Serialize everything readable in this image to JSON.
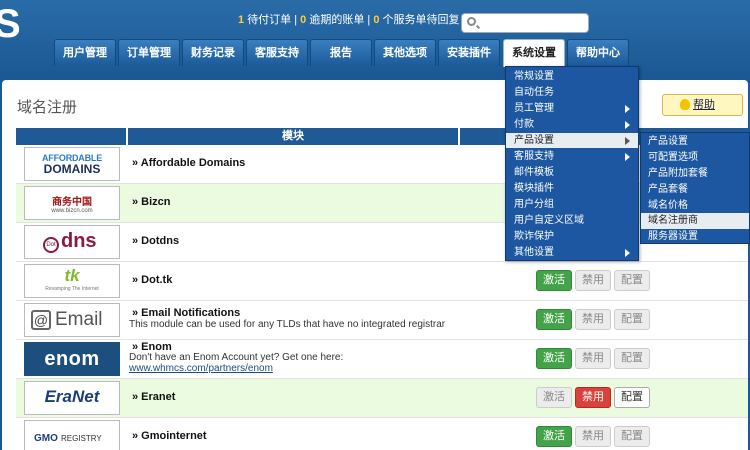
{
  "header": {
    "logo_text": "S",
    "stats": [
      {
        "count": "1",
        "label": "待付订单"
      },
      {
        "count": "0",
        "label": "逾期的账单"
      },
      {
        "count": "0",
        "label": "个服务单待回复"
      }
    ],
    "search": {
      "value": ""
    }
  },
  "nav": [
    {
      "label": "用户管理"
    },
    {
      "label": "订单管理"
    },
    {
      "label": "财务记录"
    },
    {
      "label": "客服支持"
    },
    {
      "label": "报告"
    },
    {
      "label": "其他选项"
    },
    {
      "label": "安装插件"
    },
    {
      "label": "系统设置",
      "active": true
    },
    {
      "label": "帮助中心"
    }
  ],
  "page": {
    "title": "域名注册",
    "help_label": "帮助"
  },
  "table": {
    "columns": [
      "",
      "模块",
      ""
    ],
    "rows": [
      {
        "name": "» Affordable Domains",
        "logo": [
          "AFFORDABLE",
          "DOMAINS"
        ],
        "alt": false
      },
      {
        "name": "» Bizcn",
        "logo": [
          "商务中国",
          "www.bizcn.com"
        ],
        "alt": true
      },
      {
        "name": "» Dotdns",
        "logo": [
          "Dot",
          "dns"
        ],
        "alt": false
      },
      {
        "name": "» Dot.tk",
        "logo": [
          "tk",
          "Revamping The Internet"
        ],
        "alt": false,
        "buttons": [
          "激活",
          "禁用",
          "配置"
        ]
      },
      {
        "name": "» Email Notifications",
        "desc": "This module can be used for any TLDs that have no integrated registrar",
        "logo": [
          "@",
          "Email"
        ],
        "alt": false,
        "buttons": [
          "激活",
          "禁用",
          "配置"
        ]
      },
      {
        "name": "» Enom",
        "desc": "Don't have an Enom Account yet? Get one here:",
        "link": "www.whmcs.com/partners/enom",
        "logo": [
          "enom"
        ],
        "alt": false,
        "buttons": [
          "激活",
          "禁用",
          "配置"
        ]
      },
      {
        "name": "» Eranet",
        "logo": [
          "EraNet"
        ],
        "alt": true,
        "buttons": [
          "激活",
          "禁用",
          "配置"
        ]
      },
      {
        "name": "» Gmointernet",
        "logo": [
          "GMO",
          "REGISTRY"
        ],
        "alt": false,
        "buttons": [
          "激活",
          "禁用",
          "配置"
        ]
      }
    ]
  },
  "system_menu": [
    {
      "label": "常规设置"
    },
    {
      "label": "自动任务"
    },
    {
      "label": "员工管理",
      "submenu": true
    },
    {
      "label": "付款",
      "submenu": true
    },
    {
      "label": "产品设置",
      "submenu": true,
      "highlighted": true
    },
    {
      "label": "客服支持",
      "submenu": true
    },
    {
      "label": "邮件模板"
    },
    {
      "label": "模块插件"
    },
    {
      "label": "用户分组"
    },
    {
      "label": "用户自定义区域"
    },
    {
      "label": "欺诈保护"
    },
    {
      "label": "其他设置",
      "submenu": true
    }
  ],
  "product_submenu": [
    {
      "label": "产品设置"
    },
    {
      "label": "可配置选项"
    },
    {
      "label": "产品附加套餐"
    },
    {
      "label": "产品套餐"
    },
    {
      "label": "域名价格"
    },
    {
      "label": "域名注册商",
      "highlighted": true
    },
    {
      "label": "服务器设置"
    }
  ],
  "colors": {
    "header_bg": "#1b5893",
    "accent_yellow": "#ffcc33",
    "activate_green": "#44a34a",
    "disable_red": "#d9423a",
    "row_highlight": "#eafbe0"
  }
}
